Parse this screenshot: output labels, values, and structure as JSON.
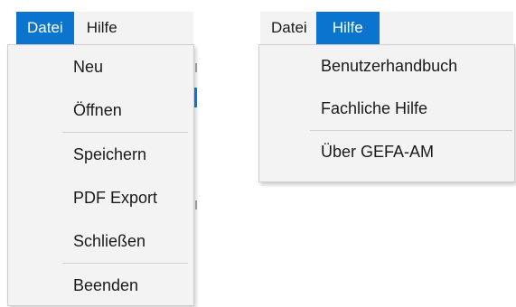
{
  "left_menu": {
    "menubar": [
      "Datei",
      "Hilfe"
    ],
    "active": "Datei",
    "items": [
      {
        "label": "Neu"
      },
      {
        "label": "Öffnen"
      },
      {
        "label": "Speichern"
      },
      {
        "label": "PDF Export"
      },
      {
        "label": "Schließen"
      },
      {
        "label": "Beenden"
      }
    ]
  },
  "right_menu": {
    "menubar": [
      "Datei",
      "Hilfe"
    ],
    "active": "Hilfe",
    "items": [
      {
        "label": "Benutzerhandbuch"
      },
      {
        "label": "Fachliche Hilfe"
      },
      {
        "label": "Über GEFA-AM"
      }
    ]
  },
  "colors": {
    "accent": "#0a74cf",
    "menu_background": "#f3f3f3",
    "separator": "#d0d0d0"
  }
}
